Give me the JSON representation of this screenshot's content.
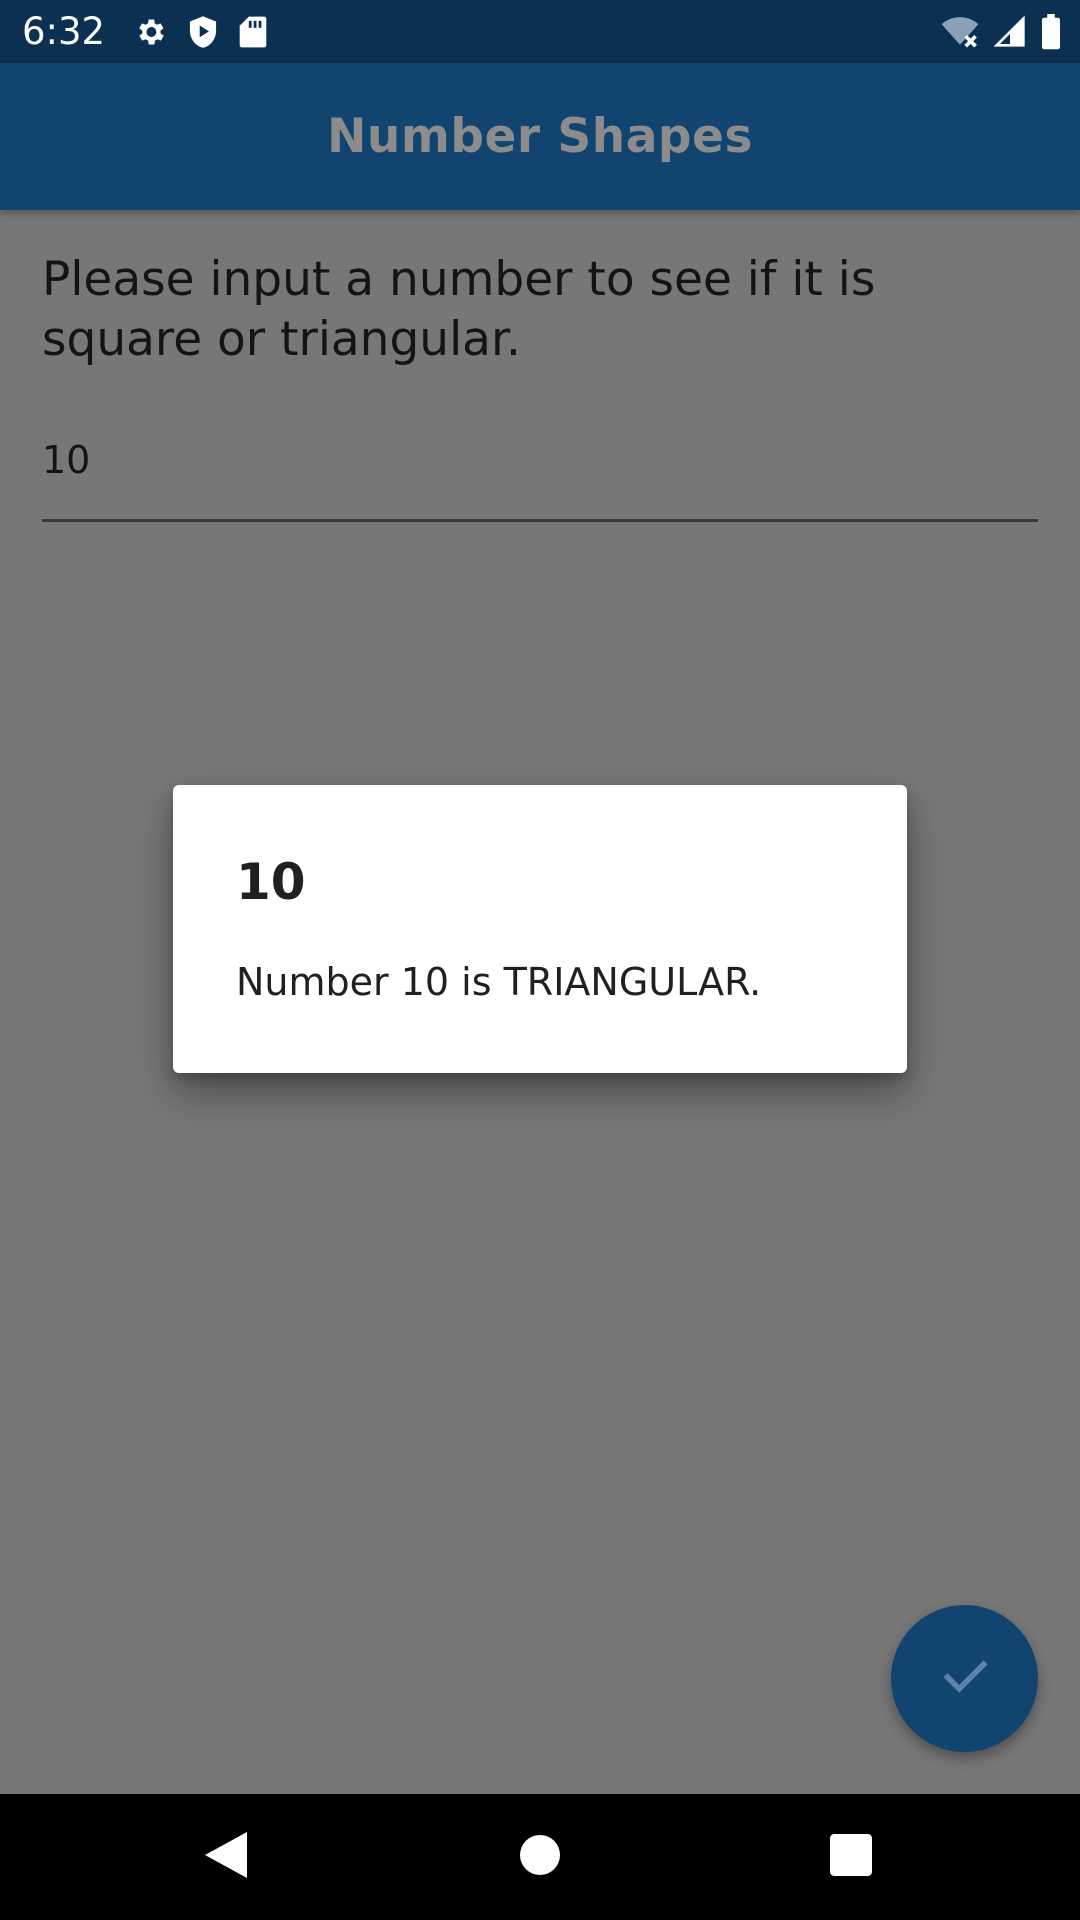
{
  "status_bar": {
    "time": "6:32",
    "left_icons": [
      "gear-icon",
      "shield-icon",
      "sd-card-icon"
    ],
    "right_icons": [
      "wifi-off-icon",
      "cell-signal-icon",
      "battery-icon"
    ]
  },
  "app_bar": {
    "title": "Number Shapes"
  },
  "main": {
    "prompt": "Please input a number to see if it is square or triangular.",
    "input_value": "10"
  },
  "dialog": {
    "title": "10",
    "message": "Number 10 is TRIANGULAR."
  },
  "fab": {
    "icon": "check-icon"
  },
  "nav_bar": {
    "icons": [
      "back-icon",
      "home-icon",
      "recents-icon"
    ]
  },
  "colors": {
    "status_bar": "#0c3052",
    "app_bar": "#11446f",
    "scrim_background": "#777777",
    "fab": "#11446f"
  }
}
